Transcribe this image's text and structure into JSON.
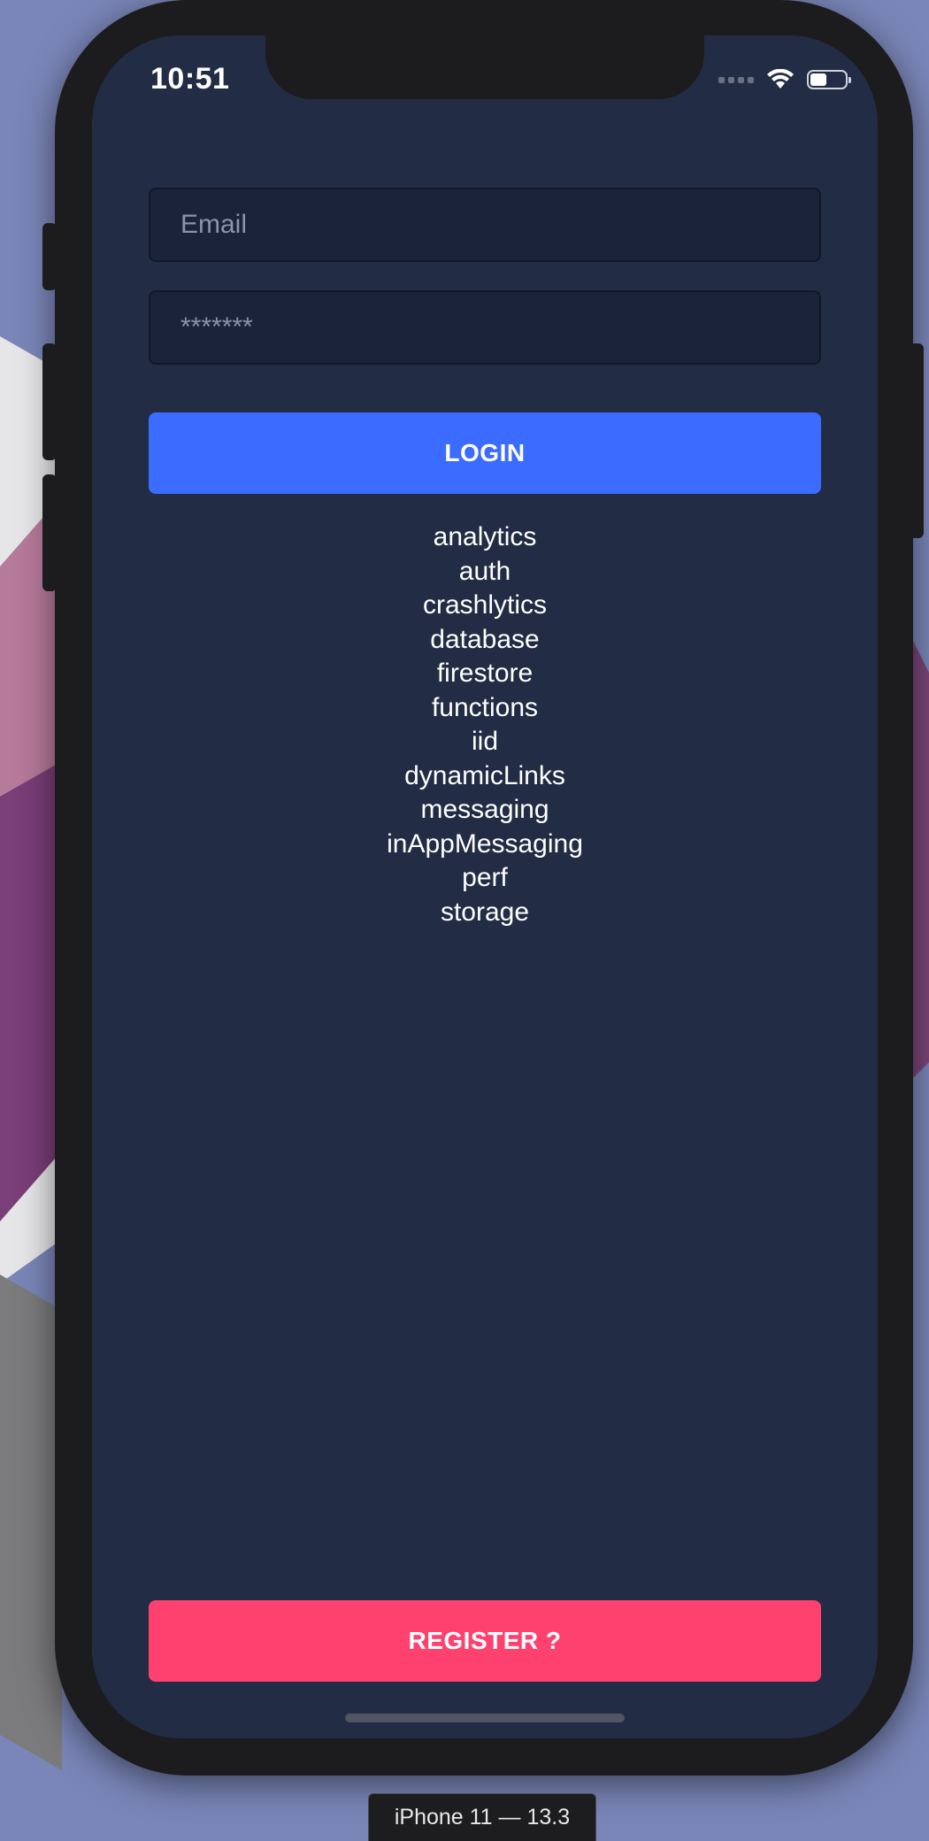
{
  "status_bar": {
    "time": "10:51"
  },
  "login_form": {
    "email_placeholder": "Email",
    "password_placeholder": "*******",
    "login_label": "LOGIN"
  },
  "modules": [
    "analytics",
    "auth",
    "crashlytics",
    "database",
    "firestore",
    "functions",
    "iid",
    "dynamicLinks",
    "messaging",
    "inAppMessaging",
    "perf",
    "storage"
  ],
  "register_label": "REGISTER ?",
  "simulator_label": "iPhone 11 — 13.3",
  "colors": {
    "screen_bg": "#222c45",
    "login_button": "#3b6cff",
    "register_button": "#ff416f"
  }
}
